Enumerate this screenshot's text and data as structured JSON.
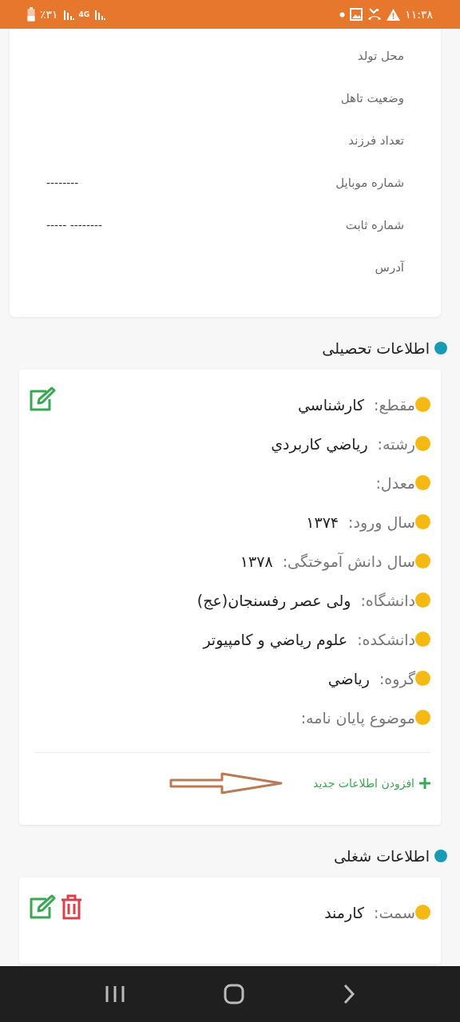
{
  "status_bar": {
    "battery": "٪۳۱",
    "network": "4G",
    "time": "۱۱:۳۸"
  },
  "personal_info": {
    "rows": [
      {
        "label": "محل تولد"
      },
      {
        "label": "وضعیت تاهل"
      },
      {
        "label": "تعداد فرزند"
      },
      {
        "label": "شماره موبایل",
        "value": "--------"
      },
      {
        "label": "شماره ثابت",
        "value": "----- --------"
      },
      {
        "label": "آدرس"
      }
    ]
  },
  "sections": [
    {
      "title": "اطلاعات تحصیلی",
      "actions": [
        {
          "kind": "edit"
        }
      ],
      "add_link": "افزودن اطلاعات جدید",
      "rows": [
        {
          "label": "مقطع:",
          "value": "کارشناسي"
        },
        {
          "label": "رشته:",
          "value": "رياضي کاربردي"
        },
        {
          "label": "معدل:"
        },
        {
          "label": "سال ورود:",
          "value": "۱۳۷۴"
        },
        {
          "label": "سال دانش آموختگی:",
          "value": "۱۳۷۸"
        },
        {
          "label": "دانشگاه:",
          "value": "ولی عصر رفسنجان(عج)"
        },
        {
          "label": "دانشکده:",
          "value": "علوم رياضي و کامپيوتر"
        },
        {
          "label": "گروه:",
          "value": "رياضي"
        },
        {
          "label": "موضوع پایان نامه:"
        }
      ]
    },
    {
      "title": "اطلاعات شغلی",
      "actions": [
        {
          "kind": "edit"
        },
        {
          "kind": "delete"
        }
      ],
      "rows": [
        {
          "label": "سمت:",
          "value": "کارمند"
        }
      ]
    }
  ]
}
